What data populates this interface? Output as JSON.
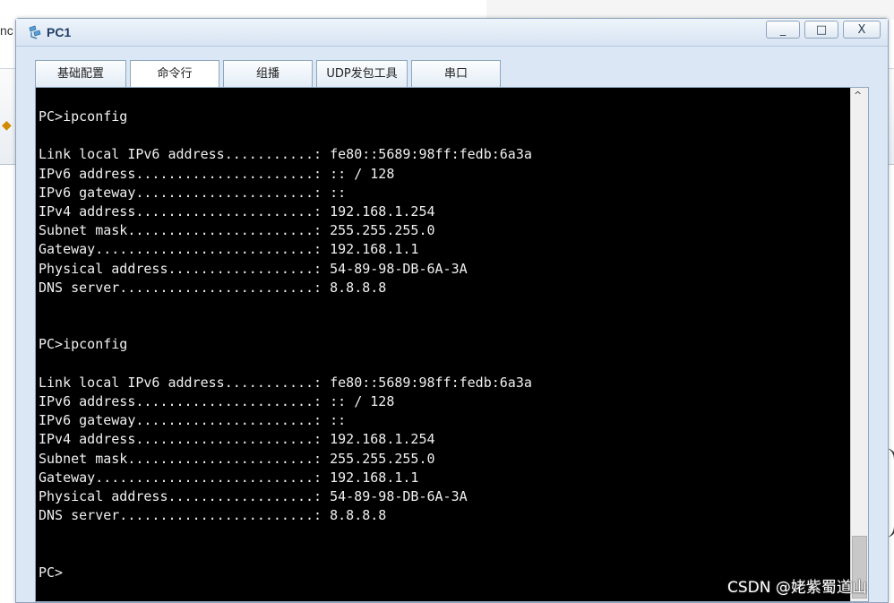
{
  "background": {
    "left_text": "nc"
  },
  "window": {
    "title": "PC1",
    "icon": "network-pc-icon",
    "controls": {
      "minimize": "_",
      "maximize": "□",
      "close": "X"
    }
  },
  "tabs": [
    {
      "label": "基础配置"
    },
    {
      "label": "命令行"
    },
    {
      "label": "组播"
    },
    {
      "label": "UDP发包工具"
    },
    {
      "label": "串口"
    }
  ],
  "terminal": {
    "lines": [
      "PC>ipconfig",
      "",
      "Link local IPv6 address...........: fe80::5689:98ff:fedb:6a3a",
      "IPv6 address......................: :: / 128",
      "IPv6 gateway......................: ::",
      "IPv4 address......................: 192.168.1.254",
      "Subnet mask.......................: 255.255.255.0",
      "Gateway...........................: 192.168.1.1",
      "Physical address..................: 54-89-98-DB-6A-3A",
      "DNS server........................: 8.8.8.8",
      "",
      "",
      "PC>ipconfig",
      "",
      "Link local IPv6 address...........: fe80::5689:98ff:fedb:6a3a",
      "IPv6 address......................: :: / 128",
      "IPv6 gateway......................: ::",
      "IPv4 address......................: 192.168.1.254",
      "Subnet mask.......................: 255.255.255.0",
      "Gateway...........................: 192.168.1.1",
      "Physical address..................: 54-89-98-DB-6A-3A",
      "DNS server........................: 8.8.8.8",
      "",
      "",
      "PC>"
    ]
  },
  "watermark": "CSDN @姥紫蜀道山",
  "colors": {
    "terminal_bg": "#000000",
    "terminal_fg": "#f0f0f0",
    "window_frame": "#dbe7f4",
    "title_text": "#1f3d66"
  }
}
